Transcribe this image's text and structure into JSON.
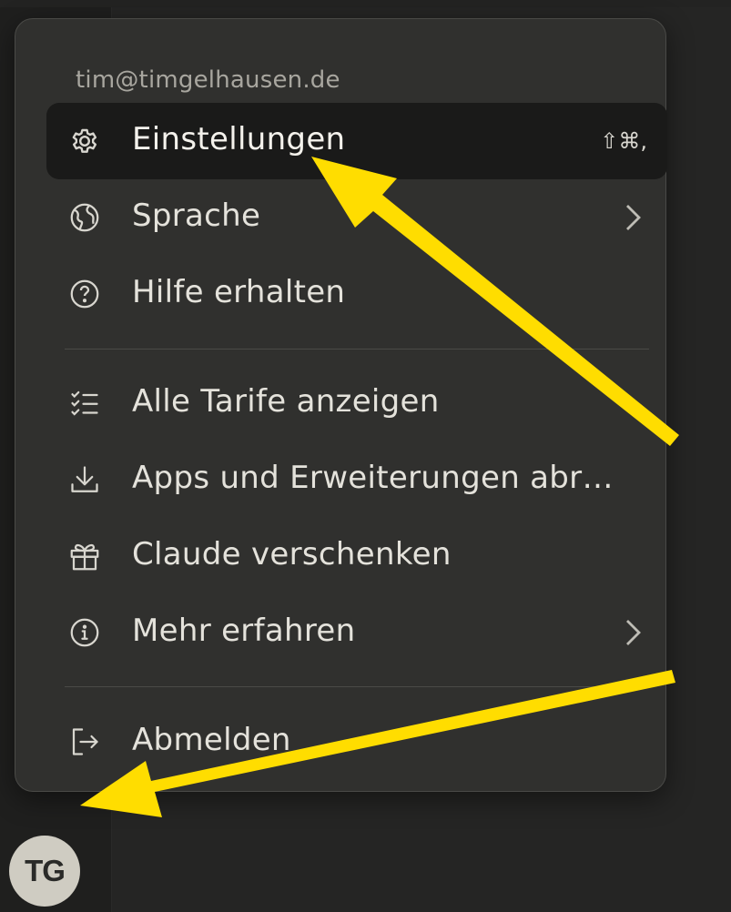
{
  "user": {
    "email": "tim@timgelhausen.de",
    "avatar_initials": "TG"
  },
  "menu": {
    "items": [
      {
        "label": "Einstellungen",
        "icon": "gear-icon",
        "shortcut": "⇧⌘,",
        "active": true
      },
      {
        "label": "Sprache",
        "icon": "globe-icon",
        "has_submenu": true
      },
      {
        "label": "Hilfe erhalten",
        "icon": "help-circle-icon"
      },
      {
        "label": "Alle Tarife anzeigen",
        "icon": "checklist-icon"
      },
      {
        "label": "Apps und Erweiterungen abr…",
        "icon": "download-icon"
      },
      {
        "label": "Claude verschenken",
        "icon": "gift-icon"
      },
      {
        "label": "Mehr erfahren",
        "icon": "info-circle-icon",
        "has_submenu": true
      },
      {
        "label": "Abmelden",
        "icon": "logout-icon"
      }
    ]
  },
  "annotation_color": "#ffdd00",
  "colors": {
    "menu_bg": "#30302e",
    "active_item_bg": "#1a1a19",
    "avatar_bg": "#cfccc2"
  }
}
